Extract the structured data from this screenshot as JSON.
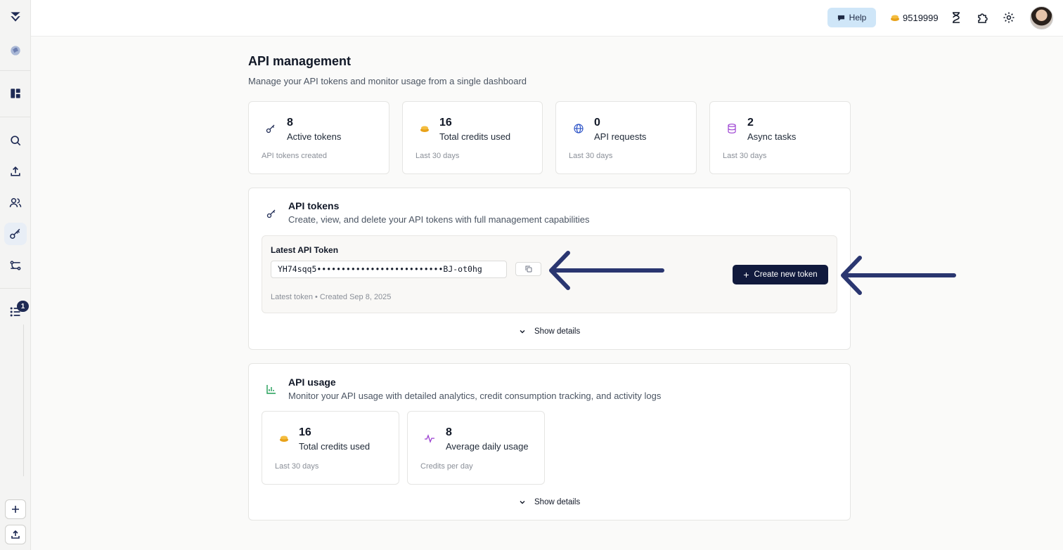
{
  "header": {
    "help_label": "Help",
    "credits_value": "9519999"
  },
  "page": {
    "title": "API management",
    "subtitle": "Manage your API tokens and monitor usage from a single dashboard"
  },
  "stats": [
    {
      "value": "8",
      "label": "Active tokens",
      "foot": "API tokens created",
      "icon": "key-icon"
    },
    {
      "value": "16",
      "label": "Total credits used",
      "foot": "Last 30 days",
      "icon": "coins-icon"
    },
    {
      "value": "0",
      "label": "API requests",
      "foot": "Last 30 days",
      "icon": "globe-icon"
    },
    {
      "value": "2",
      "label": "Async tasks",
      "foot": "Last 30 days",
      "icon": "database-icon"
    }
  ],
  "tokens_section": {
    "title": "API tokens",
    "subtitle": "Create, view, and delete your API tokens with full management capabilities",
    "latest_label": "Latest API Token",
    "token_value": "YH74sqq5••••••••••••••••••••••••••BJ-ot0hg",
    "meta": "Latest token • Created Sep 8, 2025",
    "create_label": "Create new token",
    "show_details": "Show details"
  },
  "usage_section": {
    "title": "API usage",
    "subtitle": "Monitor your API usage with detailed analytics, credit consumption tracking, and activity logs",
    "stats": [
      {
        "value": "16",
        "label": "Total credits used",
        "foot": "Last 30 days",
        "icon": "coins-icon"
      },
      {
        "value": "8",
        "label": "Average daily usage",
        "foot": "Credits per day",
        "icon": "activity-icon"
      }
    ],
    "show_details": "Show details"
  },
  "sidebar": {
    "badge_count": "1"
  },
  "colors": {
    "accent_dark": "#111a3d",
    "help_bg": "#cfe6f8",
    "arrow": "#2a3670"
  }
}
